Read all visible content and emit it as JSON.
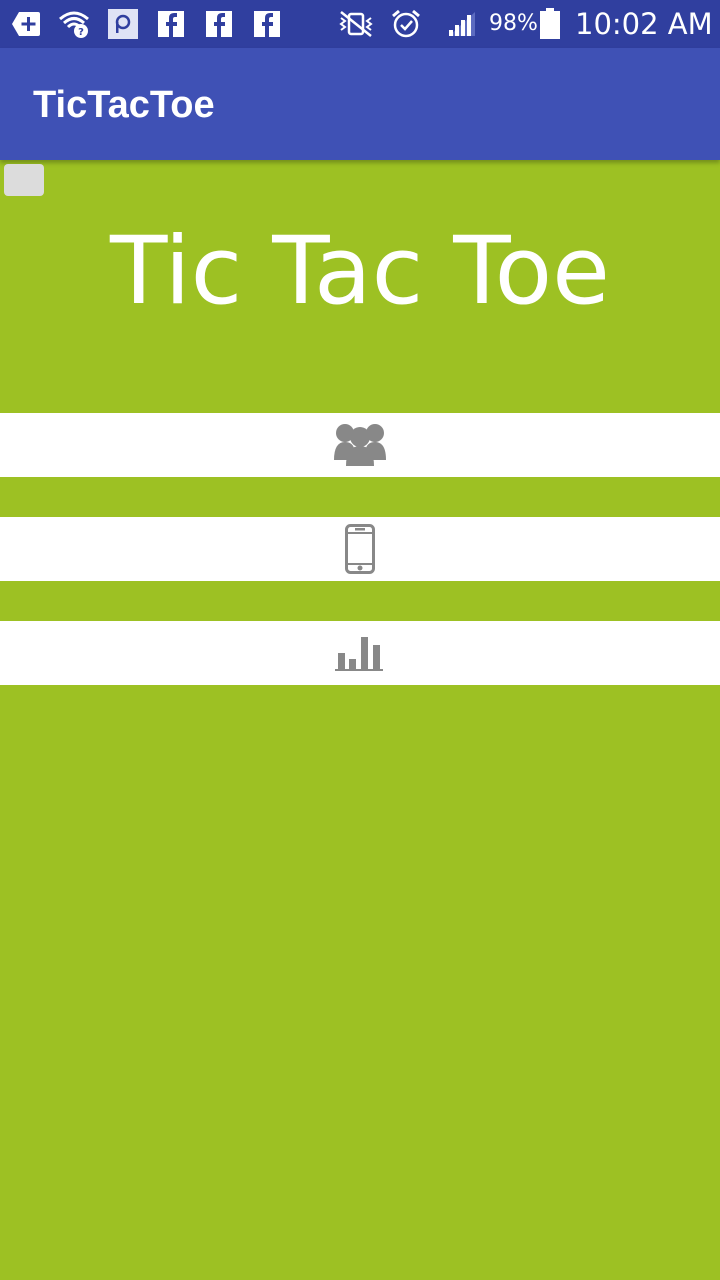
{
  "status_bar": {
    "battery_percent": "98%",
    "time": "10:02 AM",
    "colors": {
      "background": "#303f9f"
    },
    "icons": [
      "add-box-icon",
      "wifi-unknown-icon",
      "picsart-icon",
      "facebook-icon",
      "facebook-icon",
      "facebook-icon",
      "vibrate-mute-icon",
      "alarm-icon",
      "signal-icon",
      "battery-icon"
    ]
  },
  "app_bar": {
    "title": "TicTacToe",
    "colors": {
      "background": "#3f51b5"
    }
  },
  "main": {
    "headline": "Tic Tac Toe",
    "colors": {
      "background": "#9dc123",
      "bar": "#ffffff",
      "icon": "#888888"
    },
    "menu": [
      {
        "icon": "two-players-icon"
      },
      {
        "icon": "smartphone-icon"
      },
      {
        "icon": "bar-chart-icon"
      }
    ]
  }
}
